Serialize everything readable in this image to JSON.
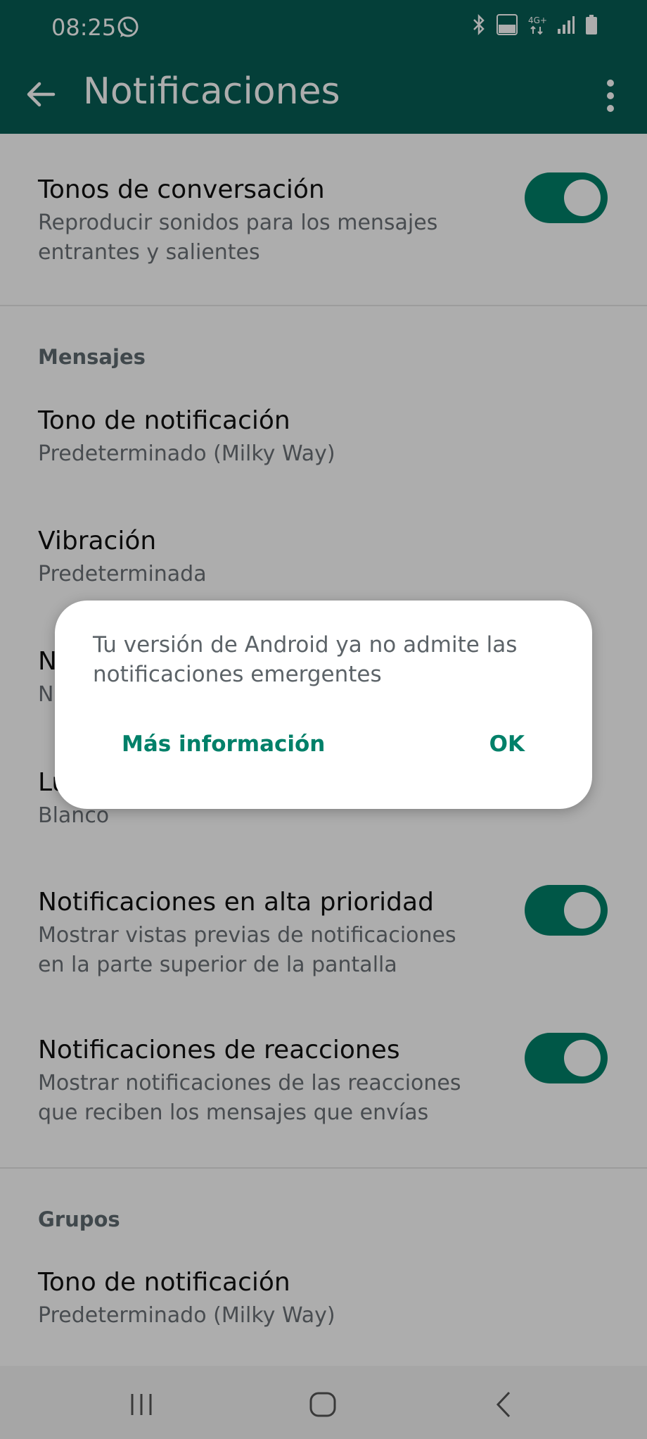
{
  "status_bar": {
    "time": "08:25",
    "icons": [
      "whatsapp-icon",
      "bluetooth-icon",
      "volte-icon",
      "4g-icon",
      "signal-icon",
      "battery-icon"
    ],
    "volte_label": "Voz 4G",
    "network_label": "4G+"
  },
  "app_bar": {
    "title": "Notificaciones",
    "back_icon": "arrow-left-icon",
    "menu_icon": "more-vert-icon"
  },
  "settings": {
    "conversation_tones": {
      "title": "Tonos de conversación",
      "subtitle": "Reproducir sonidos para los mensajes entrantes y salientes",
      "enabled": true
    },
    "messages_section": "Mensajes",
    "messages": {
      "tone": {
        "title": "Tono de notificación",
        "subtitle": "Predeterminado (Milky Way)"
      },
      "vibration": {
        "title": "Vibración",
        "subtitle": "Predeterminada"
      },
      "popup_partial_title": "N",
      "popup_partial_sub": "N",
      "light_partial_title": "Lu",
      "light_sub": "Blanco",
      "high_priority": {
        "title": "Notificaciones en alta prioridad",
        "subtitle": "Mostrar vistas previas de notificaciones en la parte superior de la pantalla",
        "enabled": true
      },
      "reactions": {
        "title": "Notificaciones de reacciones",
        "subtitle": "Mostrar notificaciones de las reacciones que reciben los mensajes que envías",
        "enabled": true
      }
    },
    "groups_section": "Grupos",
    "groups": {
      "tone": {
        "title": "Tono de notificación",
        "subtitle": "Predeterminado (Milky Way)"
      }
    }
  },
  "dialog": {
    "message": "Tu versión de Android ya no admite las notificaciones emergentes",
    "more_info_label": "Más información",
    "ok_label": "OK"
  },
  "nav_bar": {
    "icons": [
      "recents-icon",
      "home-icon",
      "back-icon"
    ]
  },
  "colors": {
    "brand": "#075e54",
    "accent": "#008069"
  }
}
